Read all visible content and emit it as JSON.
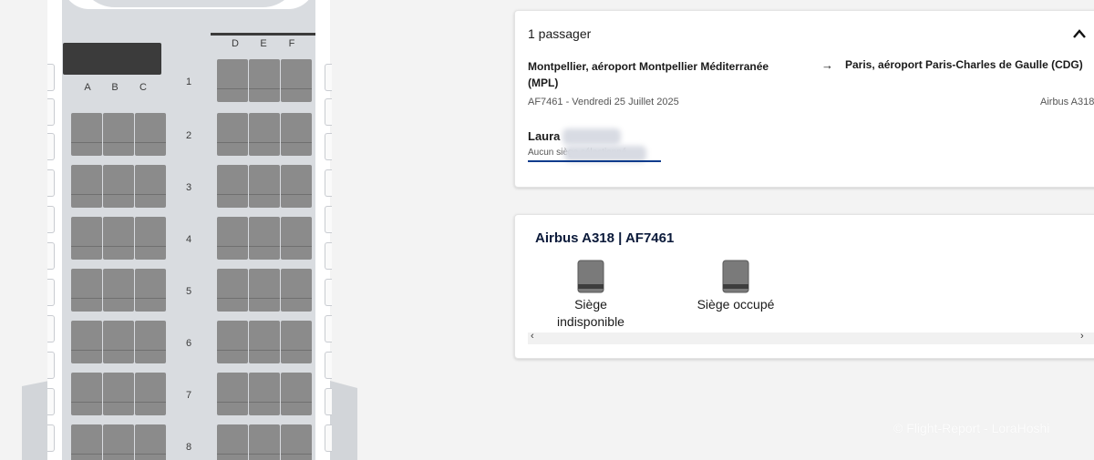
{
  "seatmap": {
    "left_columns": [
      "A",
      "B",
      "C"
    ],
    "right_columns": [
      "D",
      "E",
      "F"
    ],
    "rows": [
      "1",
      "2",
      "3",
      "4",
      "5",
      "6",
      "7",
      "8"
    ]
  },
  "passenger_panel": {
    "title": "1 passager",
    "expand_icon": "chevron-up-icon",
    "origin": "Montpellier, aéroport Montpellier Méditerranée (MPL)",
    "arrow": "→",
    "destination": "Paris, aéroport Paris-Charles de Gaulle (CDG)",
    "flight_info": "AF7461 - Vendredi 25 Juillet 2025",
    "aircraft": "Airbus A318",
    "passenger_name": "Laura",
    "seat_status": "Aucun siège sélectionné"
  },
  "legend_panel": {
    "title": "Airbus A318 | AF7461",
    "items": [
      {
        "label": "Siège indisponible",
        "icon": "seat-unavailable-icon"
      },
      {
        "label": "Siège occupé",
        "icon": "seat-occupied-icon"
      }
    ],
    "scroll_left": "‹",
    "scroll_right": "›"
  },
  "watermark": "© Flight-Report - LoraHoshi",
  "colors": {
    "seat": "#8b8b8b",
    "cabin": "#d9dce0",
    "accent": "#0b3b8c"
  }
}
